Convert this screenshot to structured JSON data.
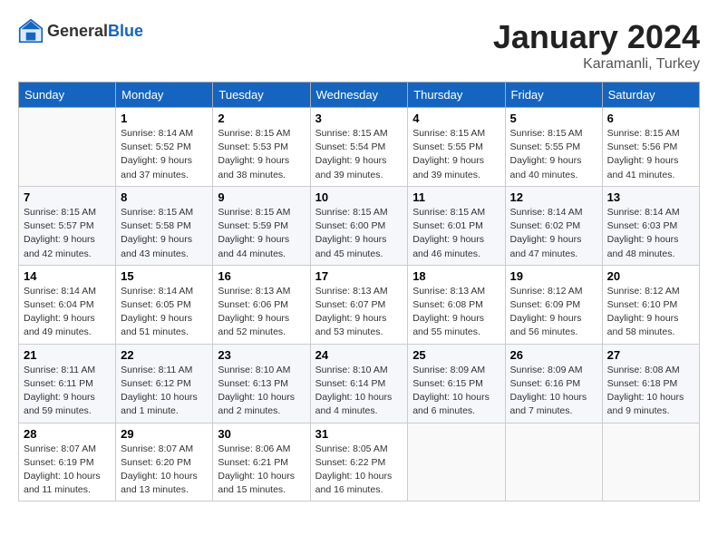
{
  "header": {
    "logo_general": "General",
    "logo_blue": "Blue",
    "month_title": "January 2024",
    "location": "Karamanli, Turkey"
  },
  "weekdays": [
    "Sunday",
    "Monday",
    "Tuesday",
    "Wednesday",
    "Thursday",
    "Friday",
    "Saturday"
  ],
  "weeks": [
    [
      {
        "day": "",
        "info": ""
      },
      {
        "day": "1",
        "info": "Sunrise: 8:14 AM\nSunset: 5:52 PM\nDaylight: 9 hours\nand 37 minutes."
      },
      {
        "day": "2",
        "info": "Sunrise: 8:15 AM\nSunset: 5:53 PM\nDaylight: 9 hours\nand 38 minutes."
      },
      {
        "day": "3",
        "info": "Sunrise: 8:15 AM\nSunset: 5:54 PM\nDaylight: 9 hours\nand 39 minutes."
      },
      {
        "day": "4",
        "info": "Sunrise: 8:15 AM\nSunset: 5:55 PM\nDaylight: 9 hours\nand 39 minutes."
      },
      {
        "day": "5",
        "info": "Sunrise: 8:15 AM\nSunset: 5:55 PM\nDaylight: 9 hours\nand 40 minutes."
      },
      {
        "day": "6",
        "info": "Sunrise: 8:15 AM\nSunset: 5:56 PM\nDaylight: 9 hours\nand 41 minutes."
      }
    ],
    [
      {
        "day": "7",
        "info": "Sunrise: 8:15 AM\nSunset: 5:57 PM\nDaylight: 9 hours\nand 42 minutes."
      },
      {
        "day": "8",
        "info": "Sunrise: 8:15 AM\nSunset: 5:58 PM\nDaylight: 9 hours\nand 43 minutes."
      },
      {
        "day": "9",
        "info": "Sunrise: 8:15 AM\nSunset: 5:59 PM\nDaylight: 9 hours\nand 44 minutes."
      },
      {
        "day": "10",
        "info": "Sunrise: 8:15 AM\nSunset: 6:00 PM\nDaylight: 9 hours\nand 45 minutes."
      },
      {
        "day": "11",
        "info": "Sunrise: 8:15 AM\nSunset: 6:01 PM\nDaylight: 9 hours\nand 46 minutes."
      },
      {
        "day": "12",
        "info": "Sunrise: 8:14 AM\nSunset: 6:02 PM\nDaylight: 9 hours\nand 47 minutes."
      },
      {
        "day": "13",
        "info": "Sunrise: 8:14 AM\nSunset: 6:03 PM\nDaylight: 9 hours\nand 48 minutes."
      }
    ],
    [
      {
        "day": "14",
        "info": "Sunrise: 8:14 AM\nSunset: 6:04 PM\nDaylight: 9 hours\nand 49 minutes."
      },
      {
        "day": "15",
        "info": "Sunrise: 8:14 AM\nSunset: 6:05 PM\nDaylight: 9 hours\nand 51 minutes."
      },
      {
        "day": "16",
        "info": "Sunrise: 8:13 AM\nSunset: 6:06 PM\nDaylight: 9 hours\nand 52 minutes."
      },
      {
        "day": "17",
        "info": "Sunrise: 8:13 AM\nSunset: 6:07 PM\nDaylight: 9 hours\nand 53 minutes."
      },
      {
        "day": "18",
        "info": "Sunrise: 8:13 AM\nSunset: 6:08 PM\nDaylight: 9 hours\nand 55 minutes."
      },
      {
        "day": "19",
        "info": "Sunrise: 8:12 AM\nSunset: 6:09 PM\nDaylight: 9 hours\nand 56 minutes."
      },
      {
        "day": "20",
        "info": "Sunrise: 8:12 AM\nSunset: 6:10 PM\nDaylight: 9 hours\nand 58 minutes."
      }
    ],
    [
      {
        "day": "21",
        "info": "Sunrise: 8:11 AM\nSunset: 6:11 PM\nDaylight: 9 hours\nand 59 minutes."
      },
      {
        "day": "22",
        "info": "Sunrise: 8:11 AM\nSunset: 6:12 PM\nDaylight: 10 hours\nand 1 minute."
      },
      {
        "day": "23",
        "info": "Sunrise: 8:10 AM\nSunset: 6:13 PM\nDaylight: 10 hours\nand 2 minutes."
      },
      {
        "day": "24",
        "info": "Sunrise: 8:10 AM\nSunset: 6:14 PM\nDaylight: 10 hours\nand 4 minutes."
      },
      {
        "day": "25",
        "info": "Sunrise: 8:09 AM\nSunset: 6:15 PM\nDaylight: 10 hours\nand 6 minutes."
      },
      {
        "day": "26",
        "info": "Sunrise: 8:09 AM\nSunset: 6:16 PM\nDaylight: 10 hours\nand 7 minutes."
      },
      {
        "day": "27",
        "info": "Sunrise: 8:08 AM\nSunset: 6:18 PM\nDaylight: 10 hours\nand 9 minutes."
      }
    ],
    [
      {
        "day": "28",
        "info": "Sunrise: 8:07 AM\nSunset: 6:19 PM\nDaylight: 10 hours\nand 11 minutes."
      },
      {
        "day": "29",
        "info": "Sunrise: 8:07 AM\nSunset: 6:20 PM\nDaylight: 10 hours\nand 13 minutes."
      },
      {
        "day": "30",
        "info": "Sunrise: 8:06 AM\nSunset: 6:21 PM\nDaylight: 10 hours\nand 15 minutes."
      },
      {
        "day": "31",
        "info": "Sunrise: 8:05 AM\nSunset: 6:22 PM\nDaylight: 10 hours\nand 16 minutes."
      },
      {
        "day": "",
        "info": ""
      },
      {
        "day": "",
        "info": ""
      },
      {
        "day": "",
        "info": ""
      }
    ]
  ]
}
